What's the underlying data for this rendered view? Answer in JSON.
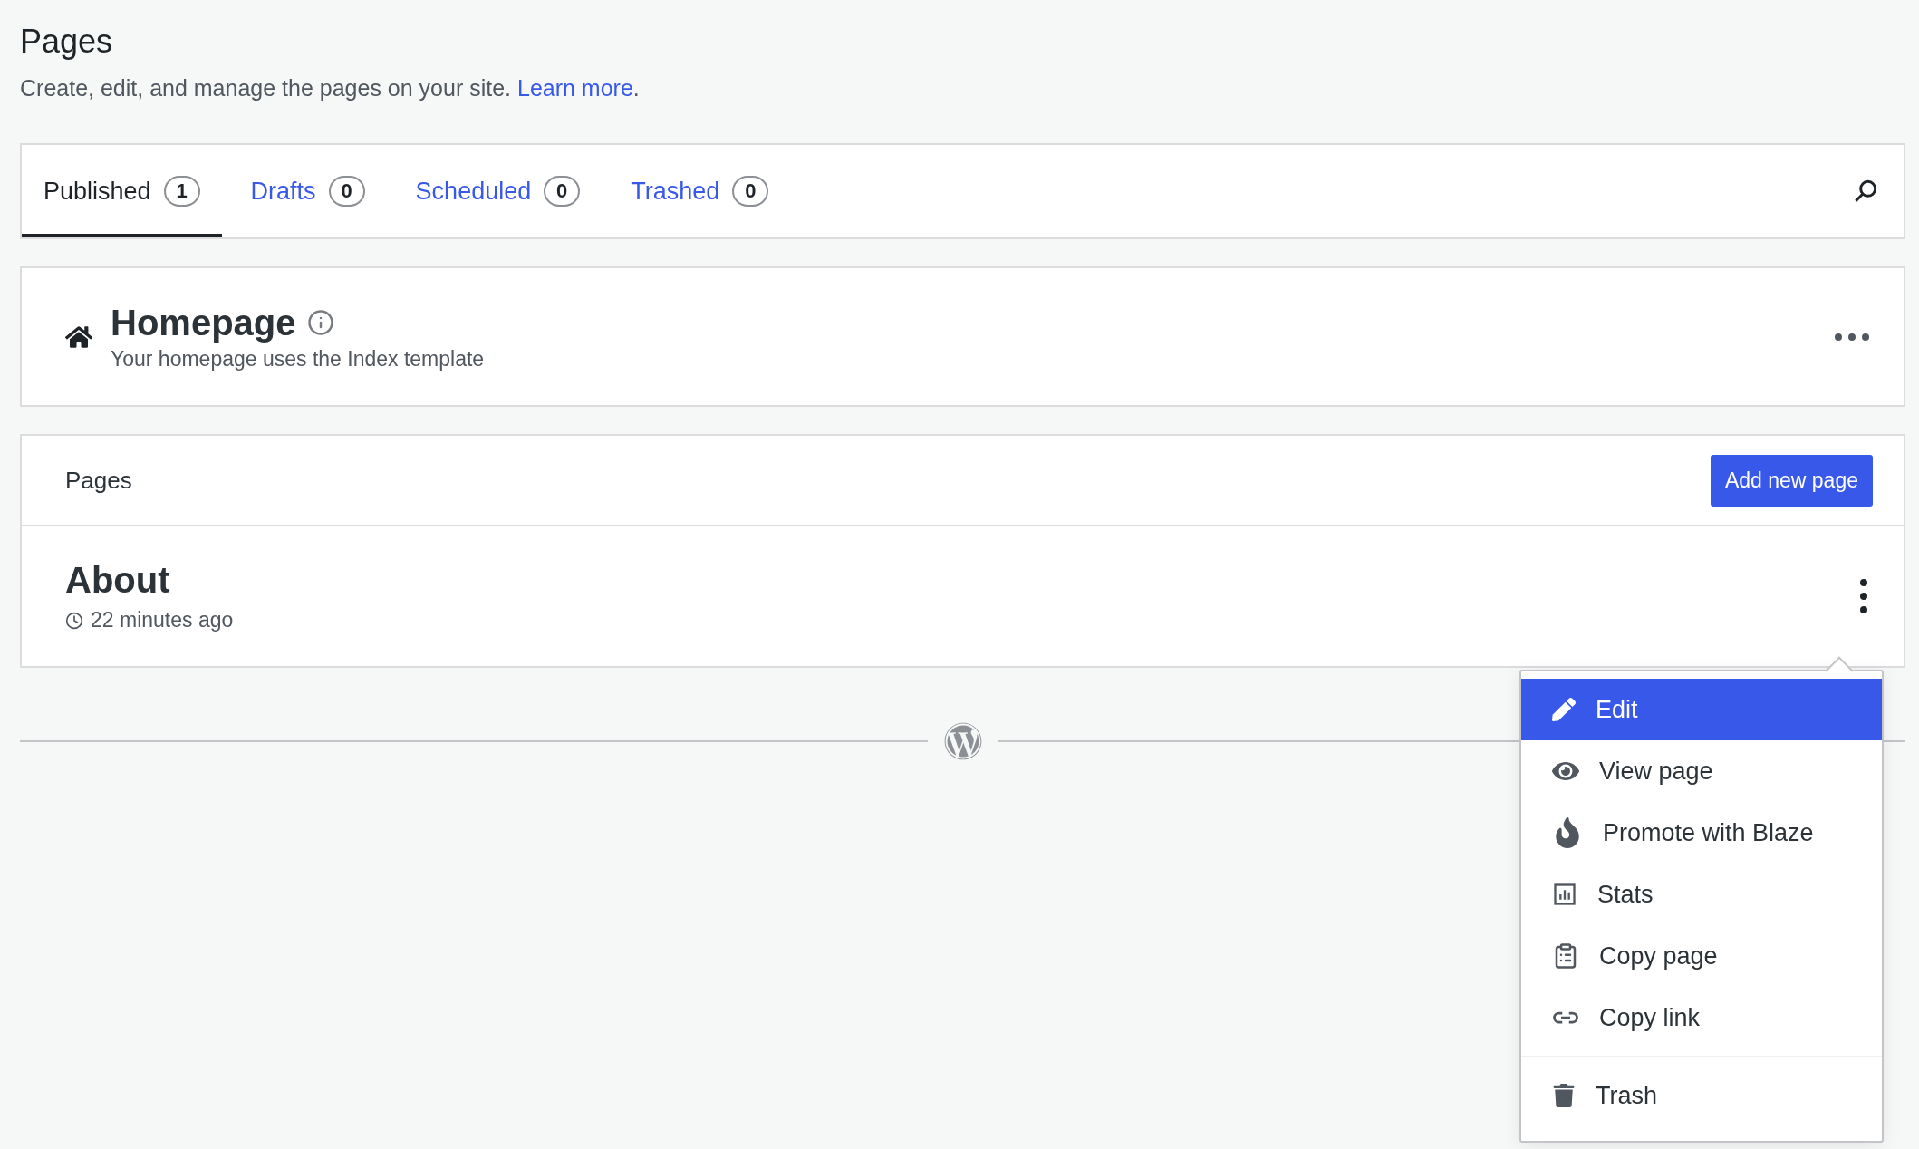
{
  "header": {
    "title": "Pages",
    "description": "Create, edit, and manage the pages on your site.",
    "link": "Learn more",
    "link_suffix": "."
  },
  "tabs": [
    {
      "label": "Published",
      "count": "1",
      "selected": true
    },
    {
      "label": "Drafts",
      "count": "0",
      "selected": false
    },
    {
      "label": "Scheduled",
      "count": "0",
      "selected": false
    },
    {
      "label": "Trashed",
      "count": "0",
      "selected": false
    }
  ],
  "homepage": {
    "title": "Homepage",
    "subtitle": "Your homepage uses the Index template"
  },
  "pages_list": {
    "heading": "Pages",
    "add_button": "Add new page",
    "rows": [
      {
        "title": "About",
        "modified": "22 minutes ago",
        "menu_open": true
      }
    ]
  },
  "menu": [
    {
      "label": "Edit",
      "selected": true,
      "divider_above": false
    },
    {
      "label": "View page",
      "selected": false,
      "divider_above": false
    },
    {
      "label": "Promote with Blaze",
      "selected": false,
      "divider_above": false
    },
    {
      "label": "Stats",
      "selected": false,
      "divider_above": false
    },
    {
      "label": "Copy page",
      "selected": false,
      "divider_above": false
    },
    {
      "label": "Copy link",
      "selected": false,
      "divider_above": false
    },
    {
      "label": "Trash",
      "selected": false,
      "divider_above": true
    }
  ]
}
